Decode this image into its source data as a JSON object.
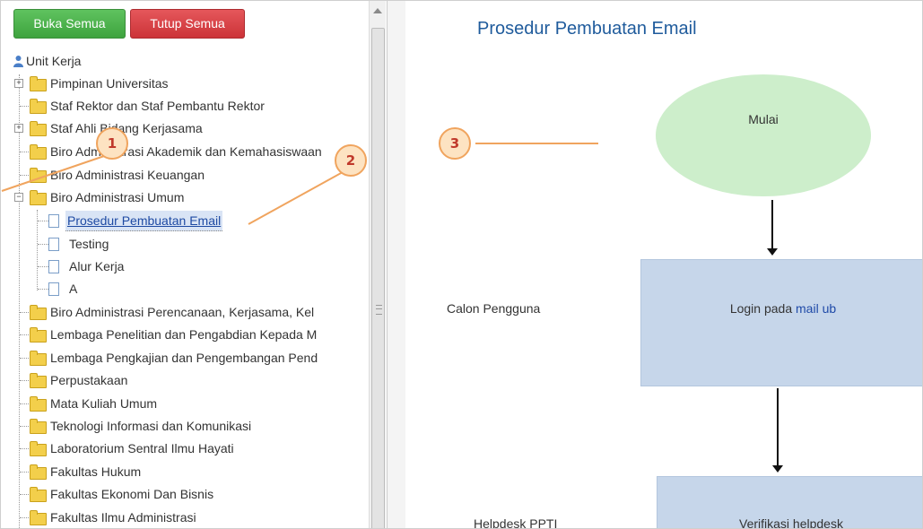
{
  "toolbar": {
    "expand_all": "Buka Semua",
    "collapse_all": "Tutup Semua"
  },
  "tree": {
    "root": "Unit Kerja",
    "items": [
      "Pimpinan Universitas",
      "Staf Rektor dan Staf Pembantu Rektor",
      "Staf Ahli Bidang Kerjasama",
      "Biro Administrasi Akademik dan Kemahasiswaan",
      "Biro Administrasi Keuangan",
      "Biro Administrasi Umum",
      "Prosedur Pembuatan Email",
      "Testing",
      "Alur Kerja",
      "A",
      "Biro Administrasi Perencanaan, Kerjasama, Kel",
      "Lembaga Penelitian dan Pengabdian Kepada M",
      "Lembaga Pengkajian dan Pengembangan Pend",
      "Perpustakaan",
      "Mata Kuliah Umum",
      "Teknologi Informasi dan Komunikasi",
      "Laboratorium Sentral Ilmu Hayati",
      "Fakultas Hukum",
      "Fakultas Ekonomi Dan Bisnis",
      "Fakultas Ilmu Administrasi"
    ]
  },
  "content": {
    "title": "Prosedur Pembuatan Email",
    "start_node": "Mulai",
    "lane1": "Calon Pengguna",
    "lane2": "Helpdesk PPTI",
    "step1_prefix": "Login pada ",
    "step1_link": "mail ub",
    "step2": "Verifikasi helpdesk"
  },
  "callouts": {
    "c1": "1",
    "c2": "2",
    "c3": "3"
  },
  "colors": {
    "accent_green": "#3ea33e",
    "accent_red": "#cc3338",
    "title_blue": "#1f5b9c",
    "ellipse_green": "#cdeecb",
    "box_blue": "#c6d6ea",
    "callout_fill": "#fde3c2",
    "callout_stroke": "#f0a45e"
  }
}
